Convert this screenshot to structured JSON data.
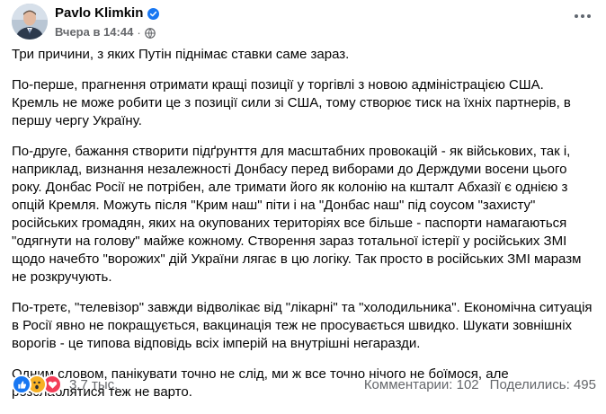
{
  "post": {
    "author": "Pavlo Klimkin",
    "timestamp": "Вчера в 14:44",
    "separator": "·",
    "icons": {
      "verified": "verified-badge-icon",
      "audience": "globe-icon",
      "more": "more-options-icon",
      "reactions": [
        "like-icon",
        "wow-icon",
        "love-icon"
      ]
    },
    "paragraphs": [
      "Три причини, з яких Путін піднімає ставки саме зараз.",
      "По-перше, прагнення отримати кращі позиції у торгівлі з новою адміністрацією США.\nКремль не може робити це з позиції сили зі США, тому створює тиск на їхніх партнерів, в\nпершу чергу Україну.",
      "По-друге, бажання створити підґрунття для масштабних провокацій - як військових, так і,\nнаприклад, визнання незалежності Донбасу перед виборами до Держдуми восени цього\nроку. Донбас Росії не потрібен, але тримати його як колонію на кшталт Абхазії є однією з\nопцій Кремля. Можуть після \"Крим наш\" піти і на \"Донбас наш\" під соусом \"захисту\"\nросійських громадян, яких на окупованих територіях все більше - паспорти намагаються\n\"одягнути на голову\" майже кожному. Створення зараз тотальної істерії у російських ЗМІ\nщодо начебто \"ворожих\" дій України лягає в цю логіку. Так просто в російських ЗМІ маразм\nне розкручують.",
      "По-третє, \"телевізор\" завжди відволікає від \"лікарні\" та \"холодильника\". Економічна ситуація\nв Росії явно не покращується, вакцинація теж не просувається швидко. Шукати зовнішніх\nворогів - це типова відповідь всіх імперій на внутрішні негаразди.",
      "Одним словом, панікувати точно не слід, ми ж все точно нічого не боїмося, але\nрозслаблятися теж не варто."
    ],
    "reaction_count": "3,7 тыс.",
    "comments": "Комментарии: 102",
    "shares": "Поделились: 495"
  },
  "colors": {
    "primary_text": "#050505",
    "secondary_text": "#65676b",
    "like": "#1877f2",
    "wow": "#f7b125",
    "love": "#f33e58"
  }
}
